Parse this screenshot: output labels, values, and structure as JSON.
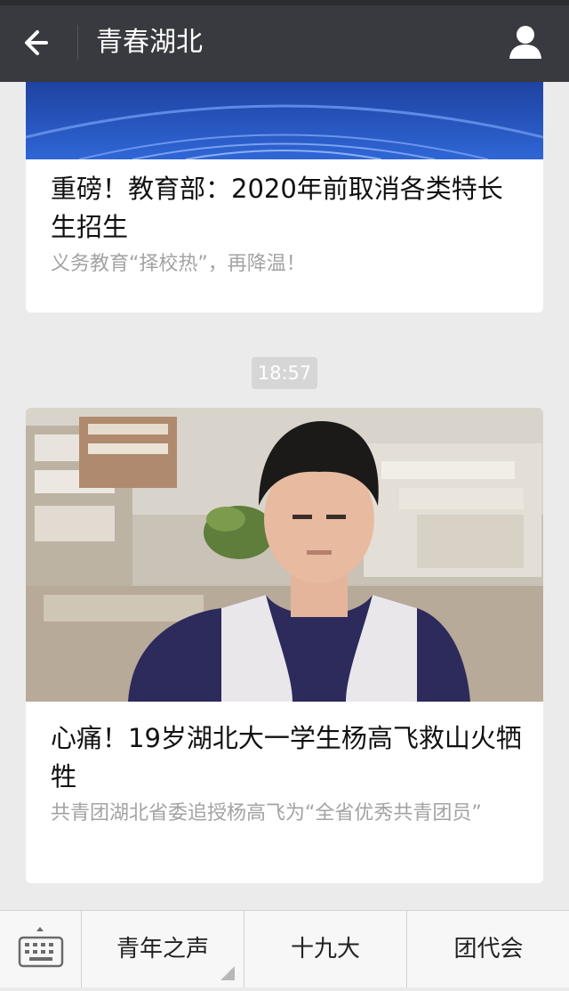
{
  "header": {
    "title": "青春湖北",
    "back_icon": "back-arrow-icon",
    "profile_icon": "person-icon"
  },
  "articles": [
    {
      "title": "重磅！教育部：2020年前取消各类特长生招生",
      "digest": "义务教育“择校热”，再降温！",
      "cover": "blue-banner-image"
    },
    {
      "title": "心痛！19岁湖北大一学生杨高飞救山火牺牲",
      "digest": "共青团湖北省委追授杨高飞为“全省优秀共青团员”",
      "cover": "student-portrait-classroom-photo"
    }
  ],
  "time_separator": "18:57",
  "tabbar": {
    "keyboard_icon": "keyboard-icon",
    "tabs": [
      "青年之声",
      "十九大",
      "团代会"
    ]
  },
  "colors": {
    "header_bg": "#393a3f",
    "page_bg": "#ebebeb",
    "card_bg": "#ffffff",
    "banner_blue": "#1f4fb8"
  }
}
